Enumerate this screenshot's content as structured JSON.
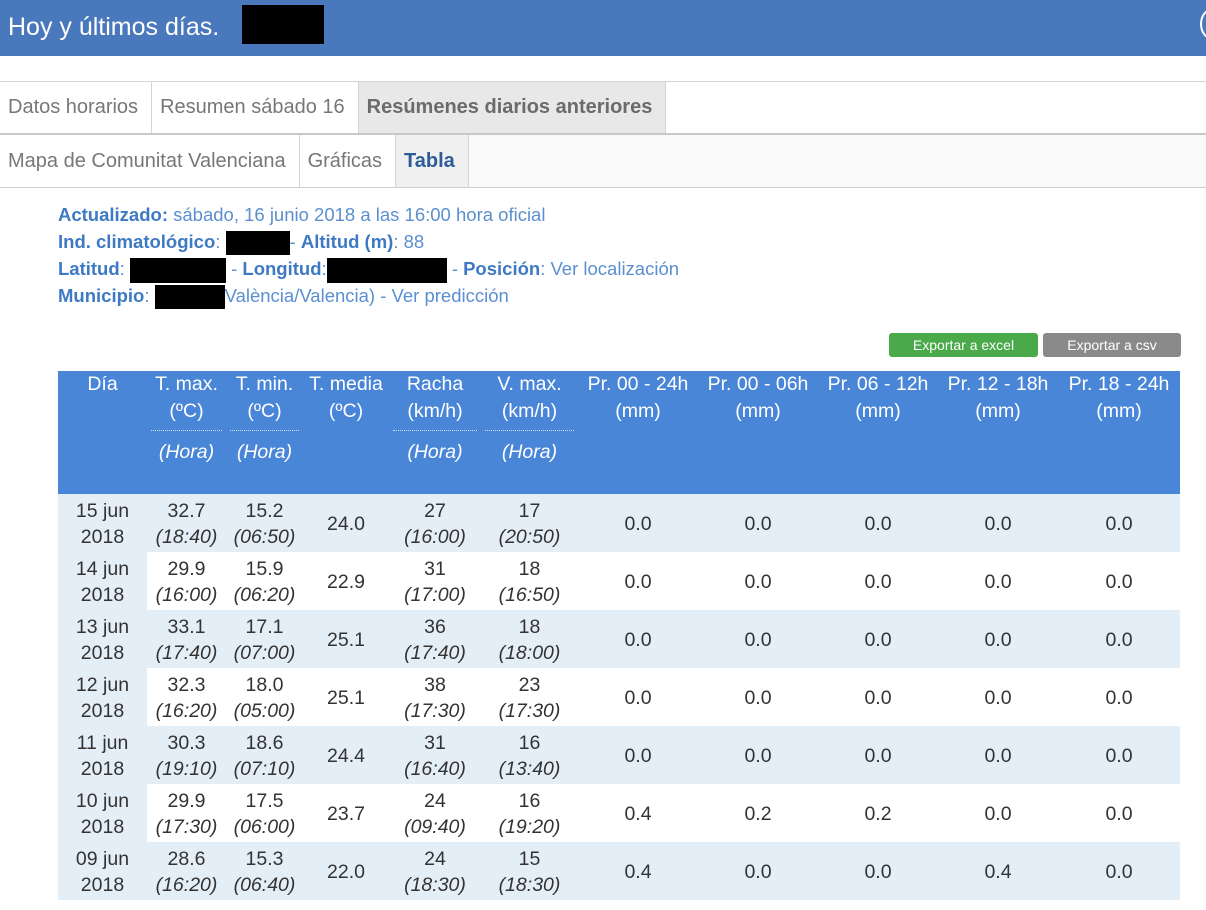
{
  "header": {
    "title": "Hoy y últimos días."
  },
  "tabs_top": [
    "Datos horarios",
    "Resumen sábado 16",
    "Resúmenes diarios anteriores"
  ],
  "tabs_top_active": 2,
  "tabs_sub": [
    "Mapa de Comunitat Valenciana",
    "Gráficas",
    "Tabla"
  ],
  "tabs_sub_active": 2,
  "info": {
    "actualizado_label": "Actualizado:",
    "actualizado_value": "sábado, 16 junio 2018 a las 16:00 hora oficial",
    "ind_label": "Ind. climatológico",
    "altitud_label": "Altitud (m)",
    "altitud_value": ": 88",
    "latitud_label": "Latitud",
    "longitud_label": "Longitud",
    "posicion_label": "Posición",
    "posicion_link": "Ver localización",
    "municipio_label": "Municipio",
    "municipio_value": "València/Valencia)",
    "prediccion_link": "Ver predicción"
  },
  "buttons": {
    "excel": "Exportar a excel",
    "csv": "Exportar a csv"
  },
  "table": {
    "headers": [
      {
        "l1": "Día",
        "l2": "",
        "hora": ""
      },
      {
        "l1": "T. max.",
        "l2": "(ºC)",
        "hora": "(Hora)"
      },
      {
        "l1": "T. min.",
        "l2": "(ºC)",
        "hora": "(Hora)"
      },
      {
        "l1": "T. media",
        "l2": "(ºC)",
        "hora": ""
      },
      {
        "l1": "Racha",
        "l2": "(km/h)",
        "hora": "(Hora)"
      },
      {
        "l1": "V. max.",
        "l2": "(km/h)",
        "hora": "(Hora)"
      },
      {
        "l1": "Pr. 00 - 24h",
        "l2": "(mm)",
        "hora": ""
      },
      {
        "l1": "Pr. 00 - 06h",
        "l2": "(mm)",
        "hora": ""
      },
      {
        "l1": "Pr. 06 - 12h",
        "l2": "(mm)",
        "hora": ""
      },
      {
        "l1": "Pr. 12 - 18h",
        "l2": "(mm)",
        "hora": ""
      },
      {
        "l1": "Pr. 18 - 24h",
        "l2": "(mm)",
        "hora": ""
      }
    ],
    "rows": [
      {
        "day": "15 jun",
        "year": "2018",
        "tmax": "32.7",
        "tmax_h": "(18:40)",
        "tmin": "15.2",
        "tmin_h": "(06:50)",
        "tmed": "24.0",
        "racha": "27",
        "racha_h": "(16:00)",
        "vmax": "17",
        "vmax_h": "(20:50)",
        "p24": "0.0",
        "p06": "0.0",
        "p12": "0.0",
        "p18": "0.0",
        "p2418": "0.0"
      },
      {
        "day": "14 jun",
        "year": "2018",
        "tmax": "29.9",
        "tmax_h": "(16:00)",
        "tmin": "15.9",
        "tmin_h": "(06:20)",
        "tmed": "22.9",
        "racha": "31",
        "racha_h": "(17:00)",
        "vmax": "18",
        "vmax_h": "(16:50)",
        "p24": "0.0",
        "p06": "0.0",
        "p12": "0.0",
        "p18": "0.0",
        "p2418": "0.0"
      },
      {
        "day": "13 jun",
        "year": "2018",
        "tmax": "33.1",
        "tmax_h": "(17:40)",
        "tmin": "17.1",
        "tmin_h": "(07:00)",
        "tmed": "25.1",
        "racha": "36",
        "racha_h": "(17:40)",
        "vmax": "18",
        "vmax_h": "(18:00)",
        "p24": "0.0",
        "p06": "0.0",
        "p12": "0.0",
        "p18": "0.0",
        "p2418": "0.0"
      },
      {
        "day": "12 jun",
        "year": "2018",
        "tmax": "32.3",
        "tmax_h": "(16:20)",
        "tmin": "18.0",
        "tmin_h": "(05:00)",
        "tmed": "25.1",
        "racha": "38",
        "racha_h": "(17:30)",
        "vmax": "23",
        "vmax_h": "(17:30)",
        "p24": "0.0",
        "p06": "0.0",
        "p12": "0.0",
        "p18": "0.0",
        "p2418": "0.0"
      },
      {
        "day": "11 jun",
        "year": "2018",
        "tmax": "30.3",
        "tmax_h": "(19:10)",
        "tmin": "18.6",
        "tmin_h": "(07:10)",
        "tmed": "24.4",
        "racha": "31",
        "racha_h": "(16:40)",
        "vmax": "16",
        "vmax_h": "(13:40)",
        "p24": "0.0",
        "p06": "0.0",
        "p12": "0.0",
        "p18": "0.0",
        "p2418": "0.0"
      },
      {
        "day": "10 jun",
        "year": "2018",
        "tmax": "29.9",
        "tmax_h": "(17:30)",
        "tmin": "17.5",
        "tmin_h": "(06:00)",
        "tmed": "23.7",
        "racha": "24",
        "racha_h": "(09:40)",
        "vmax": "16",
        "vmax_h": "(19:20)",
        "p24": "0.4",
        "p06": "0.2",
        "p12": "0.2",
        "p18": "0.0",
        "p2418": "0.0"
      },
      {
        "day": "09 jun",
        "year": "2018",
        "tmax": "28.6",
        "tmax_h": "(16:20)",
        "tmin": "15.3",
        "tmin_h": "(06:40)",
        "tmed": "22.0",
        "racha": "24",
        "racha_h": "(18:30)",
        "vmax": "15",
        "vmax_h": "(18:30)",
        "p24": "0.4",
        "p06": "0.0",
        "p12": "0.0",
        "p18": "0.4",
        "p2418": "0.0"
      }
    ]
  }
}
